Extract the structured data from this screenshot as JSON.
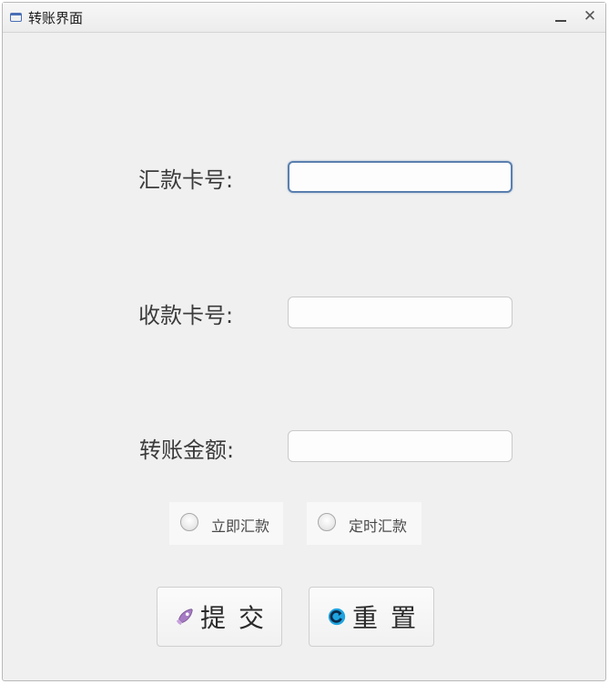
{
  "window": {
    "title": "转账界面",
    "icons": {
      "app": "window-icon",
      "minimize": "minimize-icon",
      "close": "close-icon"
    }
  },
  "form": {
    "fields": [
      {
        "label": "汇款卡号:",
        "value": "",
        "focused": true
      },
      {
        "label": "收款卡号:",
        "value": ""
      },
      {
        "label": "转账金额:",
        "value": ""
      }
    ],
    "radios": [
      {
        "label": "立即汇款",
        "checked": false
      },
      {
        "label": "定时汇款",
        "checked": false
      }
    ]
  },
  "buttons": {
    "submit": {
      "label": "提交",
      "icon": "rocket-icon",
      "icon_color": "#a77bc4"
    },
    "reset": {
      "label": "重置",
      "icon": "refresh-icon",
      "icon_color": "#1fa3e0"
    }
  },
  "colors": {
    "focus_border": "#5a7fae",
    "background": "#f0f0f0"
  }
}
